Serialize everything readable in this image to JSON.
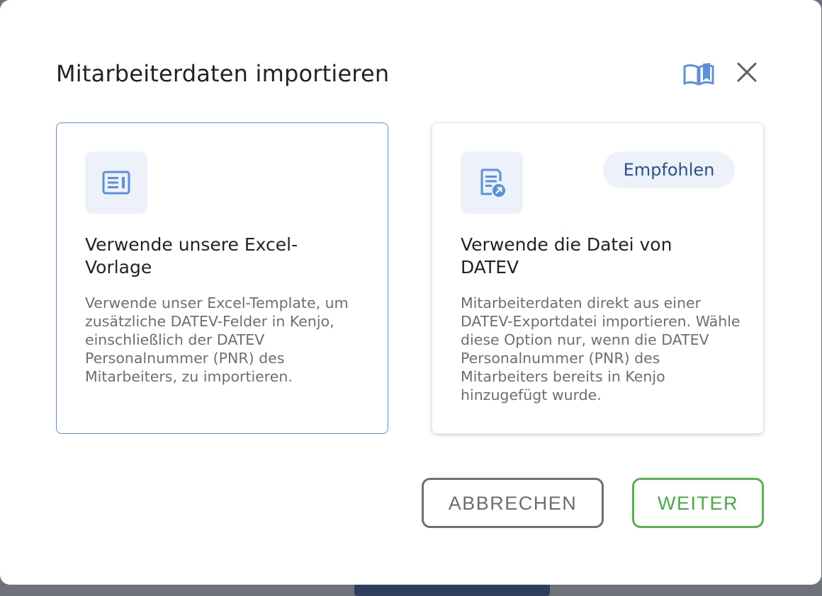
{
  "dialog": {
    "title": "Mitarbeiterdaten importieren",
    "help_icon": "book-icon",
    "close_icon": "close-icon"
  },
  "options": [
    {
      "icon": "document-list-icon",
      "title": "Verwende unsere Excel-Vorlage",
      "description": "Verwende unser Excel-Template, um zusätzliche DATEV-Felder in Kenjo, einschließlich der DATEV Personalnummer (PNR) des Mitarbeiters, zu importieren.",
      "selected": true
    },
    {
      "icon": "document-export-icon",
      "title": "Verwende die Datei von DATEV",
      "badge": "Empfohlen",
      "description": "Mitarbeiterdaten direkt aus einer DATEV-Exportdatei importieren. Wähle diese Option nur, wenn die DATEV Personalnummer (PNR) des Mitarbeiters bereits in Kenjo hinzugefügt wurde.",
      "selected": false
    }
  ],
  "actions": {
    "cancel_label": "ABBRECHEN",
    "next_label": "WEITER"
  },
  "colors": {
    "accent_blue": "#5b8fe0",
    "badge_text": "#2e4f8f",
    "next_green": "#56b24c"
  }
}
